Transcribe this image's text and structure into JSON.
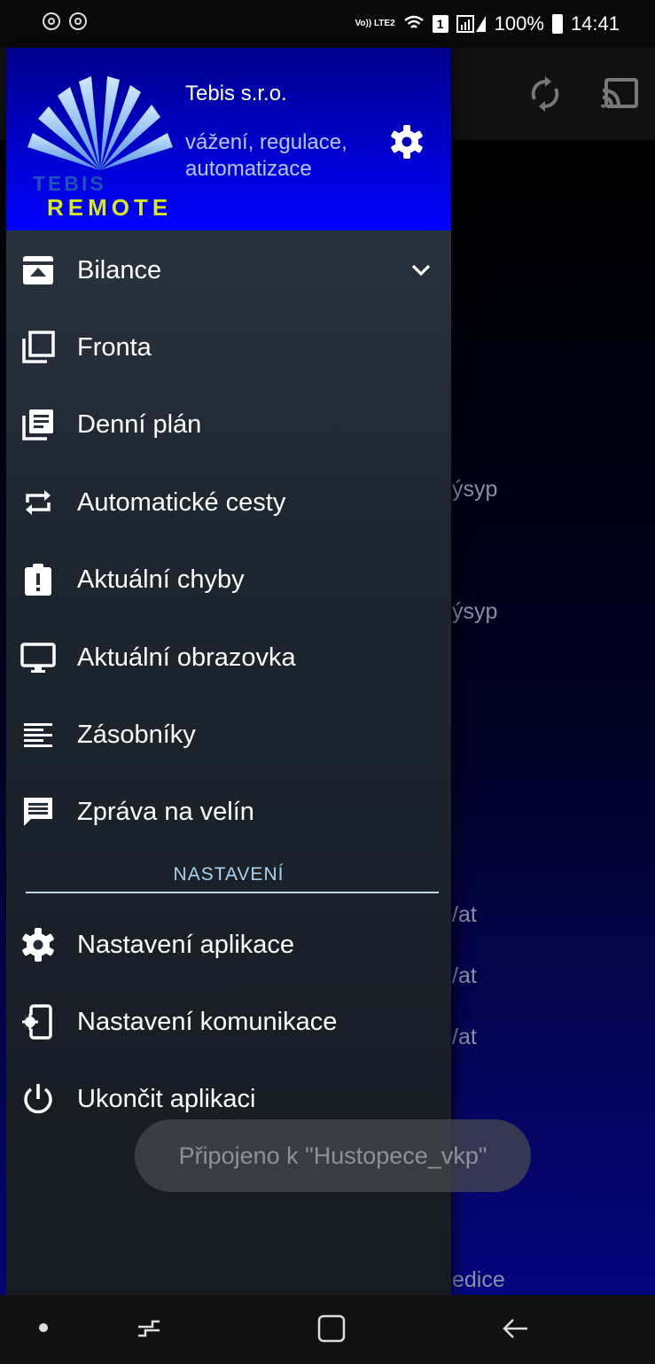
{
  "status_bar": {
    "lte_tag": "Vo)) LTE2",
    "sim_label": "1",
    "battery": "100%",
    "time": "14:41"
  },
  "header": {
    "logo_top": "TEBIS",
    "logo_bottom": "REMOTE",
    "company": "Tebis s.r.o.",
    "tagline": "vážení, regulace, automatizace"
  },
  "menu": [
    {
      "label": "Bilance",
      "icon": "upload-box-icon"
    },
    {
      "label": "Fronta",
      "icon": "layers-icon"
    },
    {
      "label": "Denní plán",
      "icon": "library-books-icon"
    },
    {
      "label": "Automatické cesty",
      "icon": "repeat-icon"
    },
    {
      "label": "Aktuální chyby",
      "icon": "clipboard-alert-icon"
    },
    {
      "label": "Aktuální obrazovka",
      "icon": "monitor-icon"
    },
    {
      "label": "Zásobníky",
      "icon": "text-lines-icon"
    },
    {
      "label": "Zpráva na velín",
      "icon": "message-icon"
    }
  ],
  "section_title": "NASTAVENÍ",
  "settings_menu": [
    {
      "label": "Nastavení aplikace",
      "icon": "gear-icon"
    },
    {
      "label": "Nastavení komunikace",
      "icon": "phone-settings-icon"
    },
    {
      "label": "Ukončit aplikaci",
      "icon": "power-icon"
    }
  ],
  "background": {
    "row1": "ýsyp",
    "row2": "ýsyp",
    "row3": "/at",
    "row4": "/at",
    "row5": "/at",
    "row6": "edice"
  },
  "toast": "Připojeno k \"Hustopece_vkp\""
}
